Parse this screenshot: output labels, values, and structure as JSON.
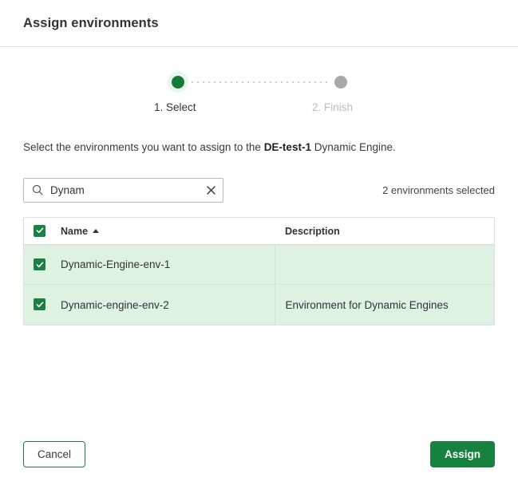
{
  "dialog": {
    "title": "Assign environments"
  },
  "stepper": {
    "steps": [
      {
        "label": "1. Select",
        "state": "active"
      },
      {
        "label": "2. Finish",
        "state": "inactive"
      }
    ]
  },
  "intro": {
    "prefix": "Select the environments you want to assign to the ",
    "engine_name": "DE-test-1",
    "suffix": " Dynamic Engine."
  },
  "search": {
    "value": "Dynam",
    "placeholder": "Search",
    "icon": "search-icon",
    "clear_icon": "close-icon"
  },
  "selection": {
    "count_label": "2 environments selected"
  },
  "table": {
    "select_all_checked": true,
    "sort_column": "Name",
    "sort_direction": "ascending",
    "columns": [
      {
        "key": "check",
        "label": ""
      },
      {
        "key": "name",
        "label": "Name"
      },
      {
        "key": "description",
        "label": "Description"
      }
    ],
    "rows": [
      {
        "selected": true,
        "name": "Dynamic-Engine-env-1",
        "description": ""
      },
      {
        "selected": true,
        "name": "Dynamic-engine-env-2",
        "description": "Environment for Dynamic Engines"
      }
    ]
  },
  "footer": {
    "cancel_label": "Cancel",
    "assign_label": "Assign"
  },
  "colors": {
    "brand_green": "#17813f",
    "step_active": "#137a3a",
    "step_inactive": "#a8a8a8",
    "row_selected_bg": "#ddf2e2",
    "checkbox_green": "#1a8043",
    "border": "#dddddd"
  }
}
